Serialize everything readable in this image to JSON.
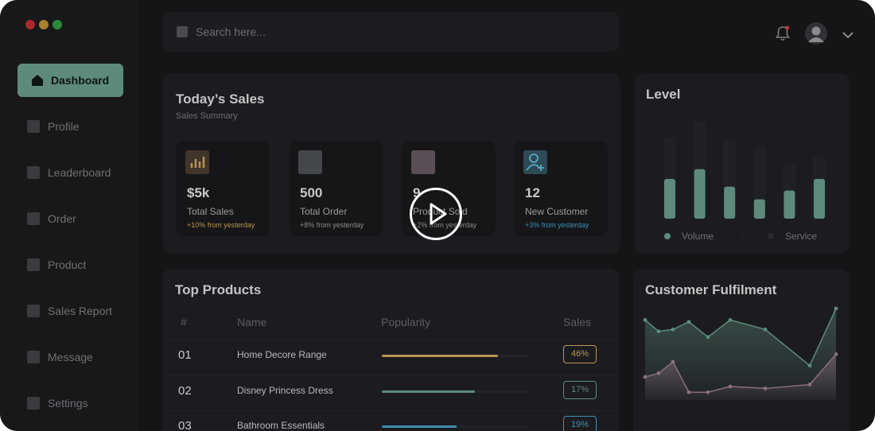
{
  "window": {
    "dots": [
      {
        "name": "close",
        "color": "#a82a2a"
      },
      {
        "name": "minimize",
        "color": "#a8822a"
      },
      {
        "name": "zoom",
        "color": "#2a8a3a"
      }
    ]
  },
  "sidebar": {
    "items": [
      {
        "label": "Dashboard",
        "icon": "home-icon",
        "active": true
      },
      {
        "label": "Profile",
        "icon": "profile-icon",
        "active": false
      },
      {
        "label": "Leaderboard",
        "icon": "leaderboard-icon",
        "active": false
      },
      {
        "label": "Order",
        "icon": "order-icon",
        "active": false
      },
      {
        "label": "Product",
        "icon": "product-icon",
        "active": false
      },
      {
        "label": "Sales Report",
        "icon": "sales-report-icon",
        "active": false
      },
      {
        "label": "Message",
        "icon": "message-icon",
        "active": false
      },
      {
        "label": "Settings",
        "icon": "settings-icon",
        "active": false
      }
    ]
  },
  "search": {
    "placeholder": "Search here...",
    "value": ""
  },
  "header": {
    "icons": [
      "bell-icon",
      "avatar",
      "chevron-down-icon"
    ]
  },
  "sales": {
    "title": "Today’s Sales",
    "subtitle": "Sales Summary",
    "stats": [
      {
        "value": "$5k",
        "label": "Total Sales",
        "change": "+10% from yesterday",
        "color": "#b89550",
        "icon_bg": "#3f352a"
      },
      {
        "value": "500",
        "label": "Total Order",
        "change": "+8% from yesterday",
        "color": "#8a8b8f",
        "icon_bg": "#44474b"
      },
      {
        "value": "9",
        "label": "Product Sold",
        "change": "+2% from yesterday",
        "color": "#8a8b8f",
        "icon_bg": "#5a4f56"
      },
      {
        "value": "12",
        "label": "New Customer",
        "change": "+3% from yesterday",
        "color": "#3e8fb0",
        "icon_bg": "#2e4a55"
      }
    ]
  },
  "level": {
    "title": "Level",
    "legend": [
      {
        "label": "Volume",
        "color": "#5d8a7c"
      },
      {
        "label": "Service",
        "color": "#2a2b2f"
      }
    ],
    "chart_data": {
      "type": "bar",
      "series": [
        {
          "name": "Volume",
          "values": [
            41,
            51,
            33,
            20,
            29,
            41
          ]
        },
        {
          "name": "Service",
          "values": [
            84,
            100,
            81,
            74,
            57,
            64
          ]
        }
      ],
      "xlabel": "",
      "ylabel": "",
      "grid": false,
      "legend": "bottom"
    }
  },
  "products": {
    "title": "Top Products",
    "headers": {
      "num": "#",
      "name": "Name",
      "popularity": "Popularity",
      "sales": "Sales"
    },
    "rows": [
      {
        "num": "01",
        "name": "Home Decore Range",
        "popularity": 0.79,
        "sales": "46%",
        "color": "#b89550"
      },
      {
        "num": "02",
        "name": "Disney Princess Dress",
        "popularity": 0.63,
        "sales": "17%",
        "color": "#5d8a7c"
      },
      {
        "num": "03",
        "name": "Bathroom Essentials",
        "popularity": 0.51,
        "sales": "19%",
        "color": "#3e8fb0"
      }
    ]
  },
  "fulfilment": {
    "title": "Customer Fulfilment",
    "chart_data": {
      "type": "area",
      "series": [
        {
          "name": "",
          "color": "#5d8a7c",
          "values": [
            80,
            74,
            75,
            79,
            71,
            80,
            75,
            56,
            86
          ]
        },
        {
          "name": "",
          "color": "#8a6f7c",
          "values": [
            50,
            52,
            58,
            42,
            42,
            45,
            44,
            46,
            62
          ]
        }
      ],
      "xlabel": "",
      "ylabel": "",
      "grid": false
    }
  },
  "overlay": {
    "icon": "play-icon"
  }
}
